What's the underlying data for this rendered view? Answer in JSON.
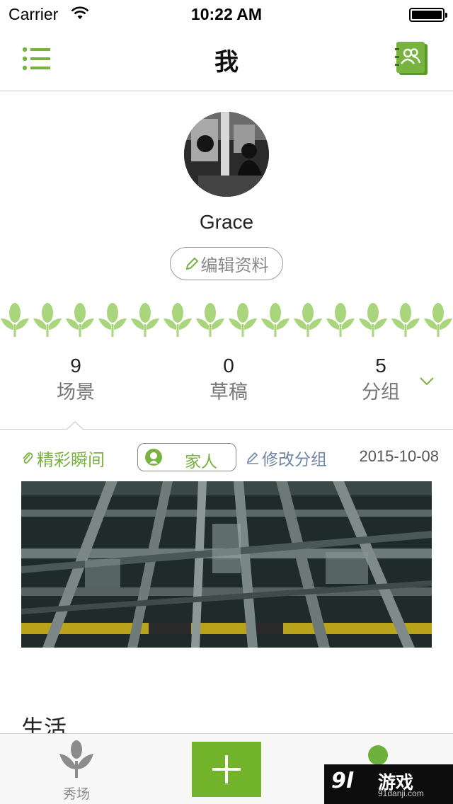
{
  "status_bar": {
    "carrier": "Carrier",
    "time": "10:22 AM",
    "wifi_icon": "wifi-icon",
    "battery_icon": "battery-icon"
  },
  "nav": {
    "title": "我",
    "left_icon": "menu-list-icon",
    "right_icon": "contacts-book-icon"
  },
  "profile": {
    "name": "Grace",
    "edit_label": "编辑资料"
  },
  "stats": [
    {
      "value": "9",
      "label": "场景"
    },
    {
      "value": "0",
      "label": "草稿"
    },
    {
      "value": "5",
      "label": "分组"
    }
  ],
  "moment": {
    "highlight_label": "精彩瞬间",
    "group_tag": "家人",
    "modify_group_label": "修改分组",
    "date": "2015-10-08"
  },
  "section": {
    "title": "生活"
  },
  "tab_bar": {
    "show_label": "秀场",
    "add_icon": "plus-icon",
    "me_icon": "person-icon"
  },
  "watermark": {
    "logo": "9l",
    "title": "游戏",
    "site": "91danji.com"
  },
  "colors": {
    "accent_green": "#78b340",
    "link_blue": "#6f86a9",
    "add_button": "#72b42c"
  }
}
